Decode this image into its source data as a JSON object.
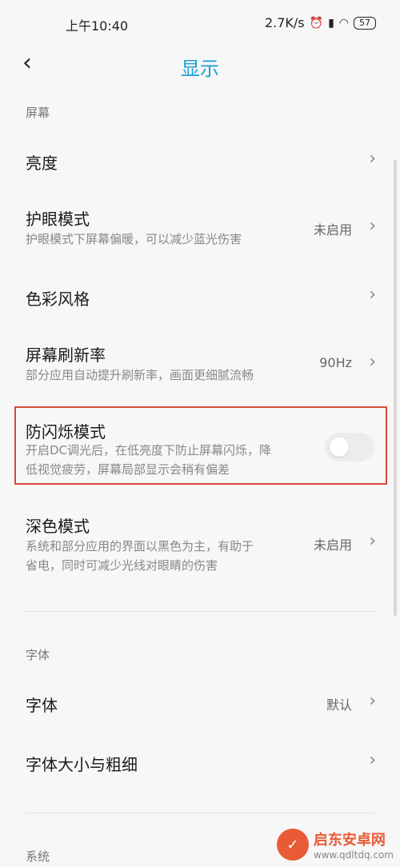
{
  "status_bar": {
    "time": "上午10:40",
    "net_speed": "2.7K/s",
    "battery": "57"
  },
  "header": {
    "back_icon": "‹",
    "title": "显示"
  },
  "sections": {
    "screen": "屏幕",
    "font": "字体",
    "system": "系统"
  },
  "items": {
    "brightness": {
      "label": "亮度"
    },
    "eye_care": {
      "label": "护眼模式",
      "sub": "护眼模式下屏幕偏暖，可以减少蓝光伤害",
      "value": "未启用"
    },
    "color_style": {
      "label": "色彩风格"
    },
    "refresh_rate": {
      "label": "屏幕刷新率",
      "sub": "部分应用自动提升刷新率，画面更细腻流畅",
      "value": "90Hz"
    },
    "anti_flicker": {
      "label": "防闪烁模式",
      "sub1": "开启DC调光后，在低亮度下防止屏幕闪烁，降",
      "sub2": "低视觉疲劳，屏幕局部显示会稍有偏差",
      "enabled": false
    },
    "dark_mode": {
      "label": "深色模式",
      "sub1": "系统和部分应用的界面以黑色为主，有助于",
      "sub2": "省电，同时可减少光线对眼睛的伤害",
      "value": "未启用"
    },
    "font": {
      "label": "字体",
      "value": "默认"
    },
    "font_size": {
      "label": "字体大小与粗细"
    }
  },
  "watermark": {
    "title": "启东安卓网",
    "url": "www.qdltdq.com"
  },
  "colors": {
    "accent": "#1a9fd8",
    "highlight_border": "#d8483c"
  }
}
